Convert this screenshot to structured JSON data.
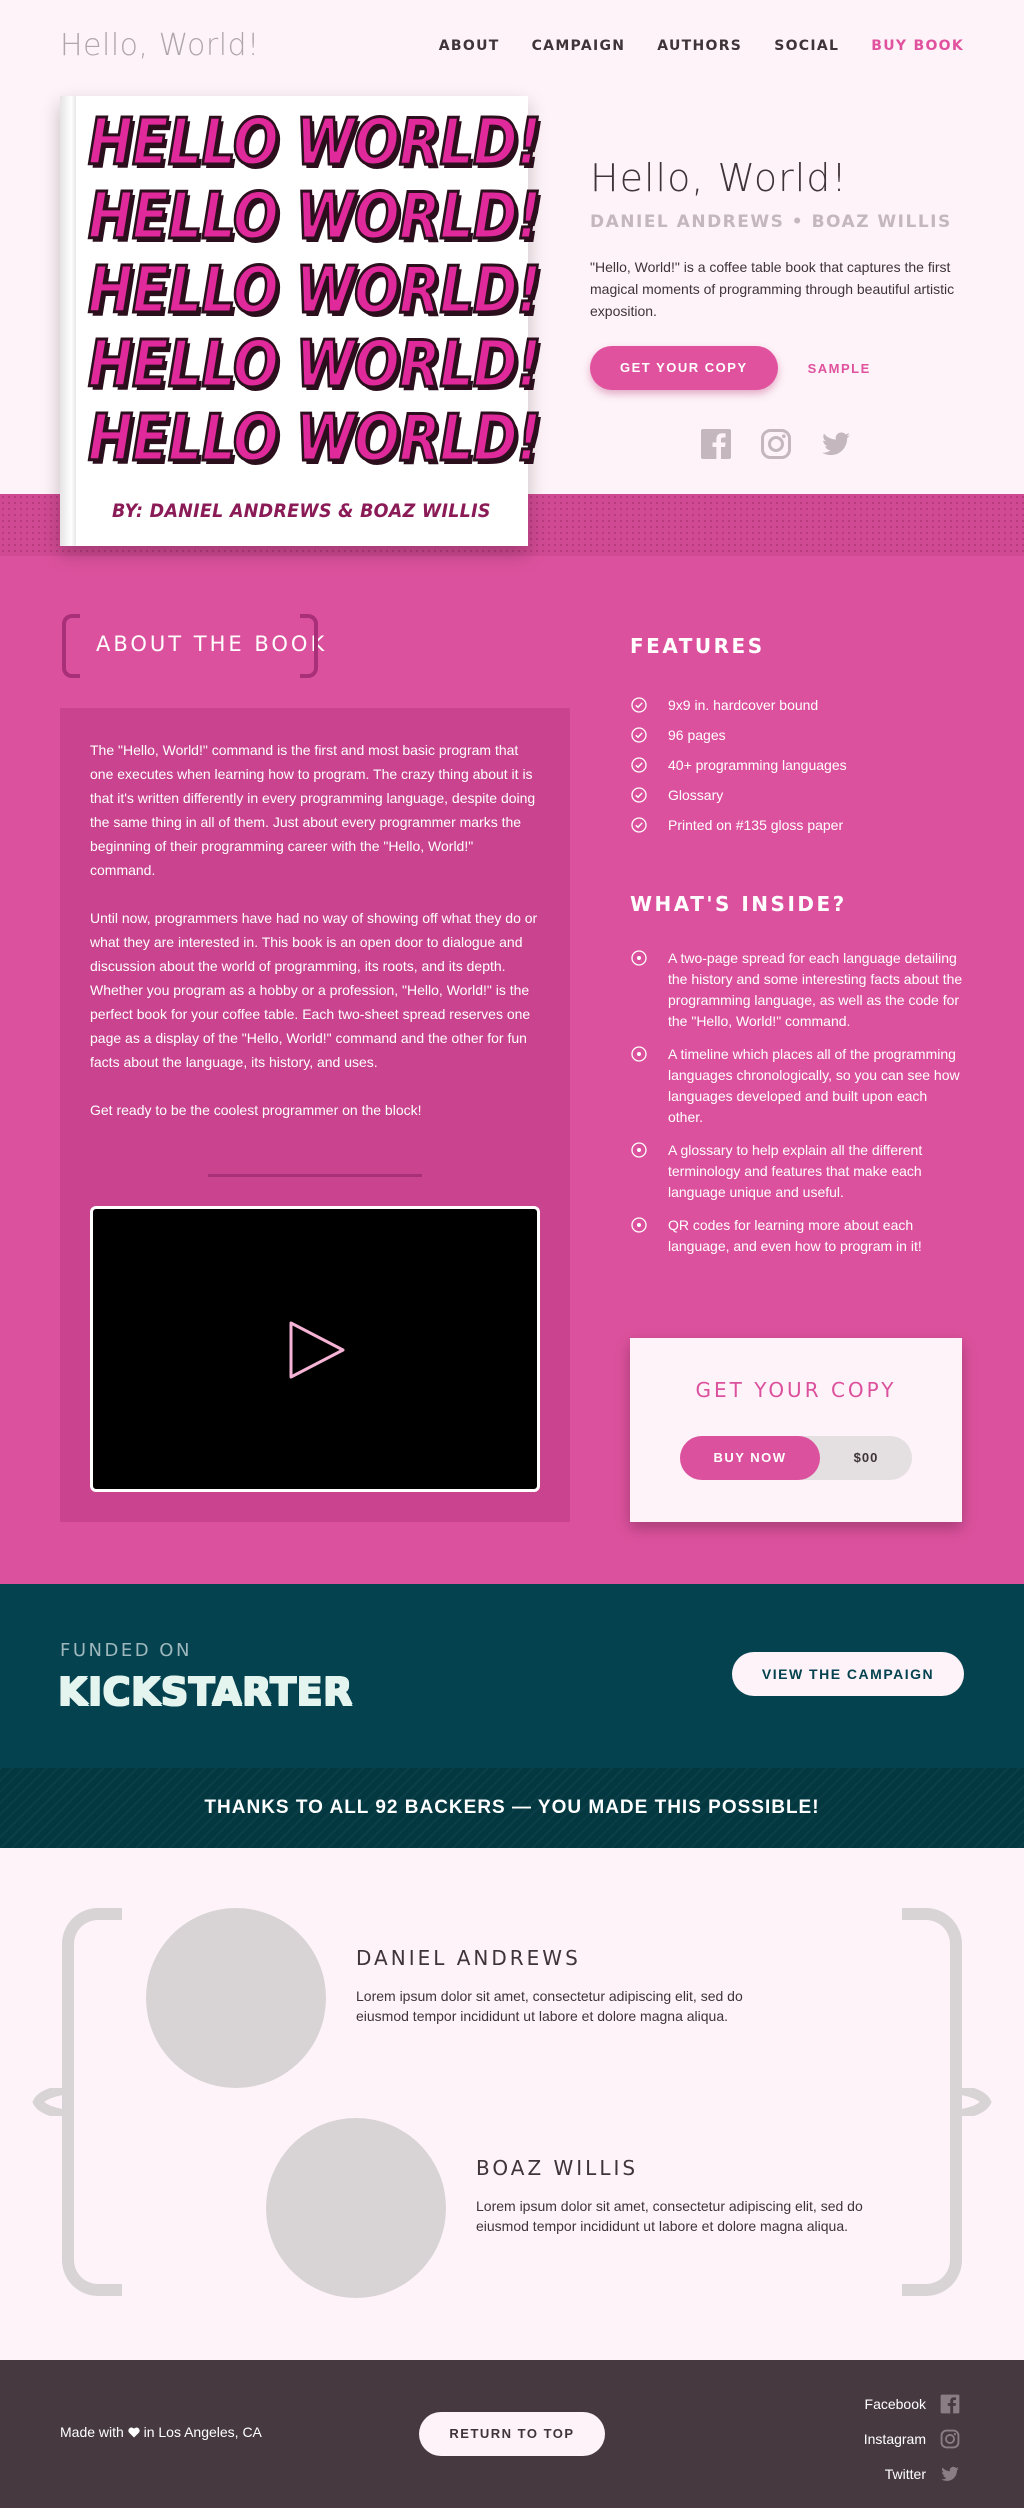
{
  "header": {
    "logo": "Hello, World!",
    "nav": [
      "ABOUT",
      "CAMPAIGN",
      "AUTHORS",
      "SOCIAL",
      "BUY BOOK"
    ]
  },
  "book_cover": {
    "words": [
      "HELLO WORLD!",
      "HELLO WORLD!",
      "HELLO WORLD!",
      "HELLO WORLD!",
      "HELLO WORLD!"
    ],
    "authors": "BY: DANIEL ANDREWS & BOAZ WILLIS"
  },
  "hero": {
    "title": "Hello, World!",
    "authors": "DANIEL ANDREWS • BOAZ WILLIS",
    "description": "\"Hello, World!\" is a coffee table book that captures the first magical moments of programming through beautiful artistic exposition.",
    "cta": "GET YOUR COPY",
    "sample": "SAMPLE",
    "social_icons": [
      "facebook-icon",
      "instagram-icon",
      "twitter-icon"
    ]
  },
  "about": {
    "heading": "ABOUT THE BOOK",
    "paragraphs": [
      "The \"Hello, World!\" command is the first and most basic program that one executes when learning how to program. The crazy thing about it is that it's written differently in every programming language, despite doing the same thing in all of them. Just about every programmer marks the beginning of their programming career with the \"Hello, World!\" command.",
      "Until now, programmers have had no way of showing off what they do or what they are interested in. This book is an open door to dialogue and discussion about the world of programming, its roots, and its depth. Whether you program as a hobby or a profession, \"Hello, World!\" is the perfect book for your coffee table. Each two-sheet spread reserves one page as a display of the \"Hello, World!\" command and the other for fun facts about the language, its history, and uses.",
      "Get ready to be the coolest programmer on the block!"
    ]
  },
  "features": {
    "title": "FEATURES",
    "items": [
      "9x9 in. hardcover bound",
      "96 pages",
      "40+ programming languages",
      "Glossary",
      "Printed on #135 gloss paper"
    ]
  },
  "inside": {
    "title": "WHAT'S INSIDE?",
    "items": [
      "A two-page spread for each language detailing the history and some interesting facts about the programming language, as well as the code for the \"Hello, World!\" command.",
      "A timeline which places all of the programming languages chronologically, so you can see how languages developed and built upon each other.",
      "A glossary to help explain all the different terminology and features that make each language unique and useful.",
      "QR codes for learning more about each language, and even how to program in it!"
    ]
  },
  "buy_card": {
    "title": "GET YOUR COPY",
    "button": "BUY NOW",
    "price": "$00"
  },
  "kickstarter": {
    "funded_on": "FUNDED ON",
    "logo": "KICKSTARTER",
    "button": "VIEW THE CAMPAIGN",
    "thanks": "THANKS TO ALL 92 BACKERS — YOU MADE THIS POSSIBLE!"
  },
  "authors": [
    {
      "name": "DANIEL ANDREWS",
      "bio": "Lorem ipsum dolor sit amet, consectetur adipiscing elit, sed do eiusmod tempor incididunt ut labore et dolore magna aliqua."
    },
    {
      "name": "BOAZ WILLIS",
      "bio": "Lorem ipsum dolor sit amet, consectetur adipiscing elit, sed do eiusmod tempor incididunt ut labore et dolore magna aliqua."
    }
  ],
  "footer": {
    "made_prefix": "Made with",
    "made_suffix": "in Los Angeles, CA",
    "return_top": "RETURN TO TOP",
    "social": [
      "Facebook",
      "Instagram",
      "Twitter"
    ]
  },
  "colors": {
    "accent_pink": "#dc519d",
    "teal": "#04424f",
    "background": "#fdf3f8",
    "footer": "#463a40"
  }
}
